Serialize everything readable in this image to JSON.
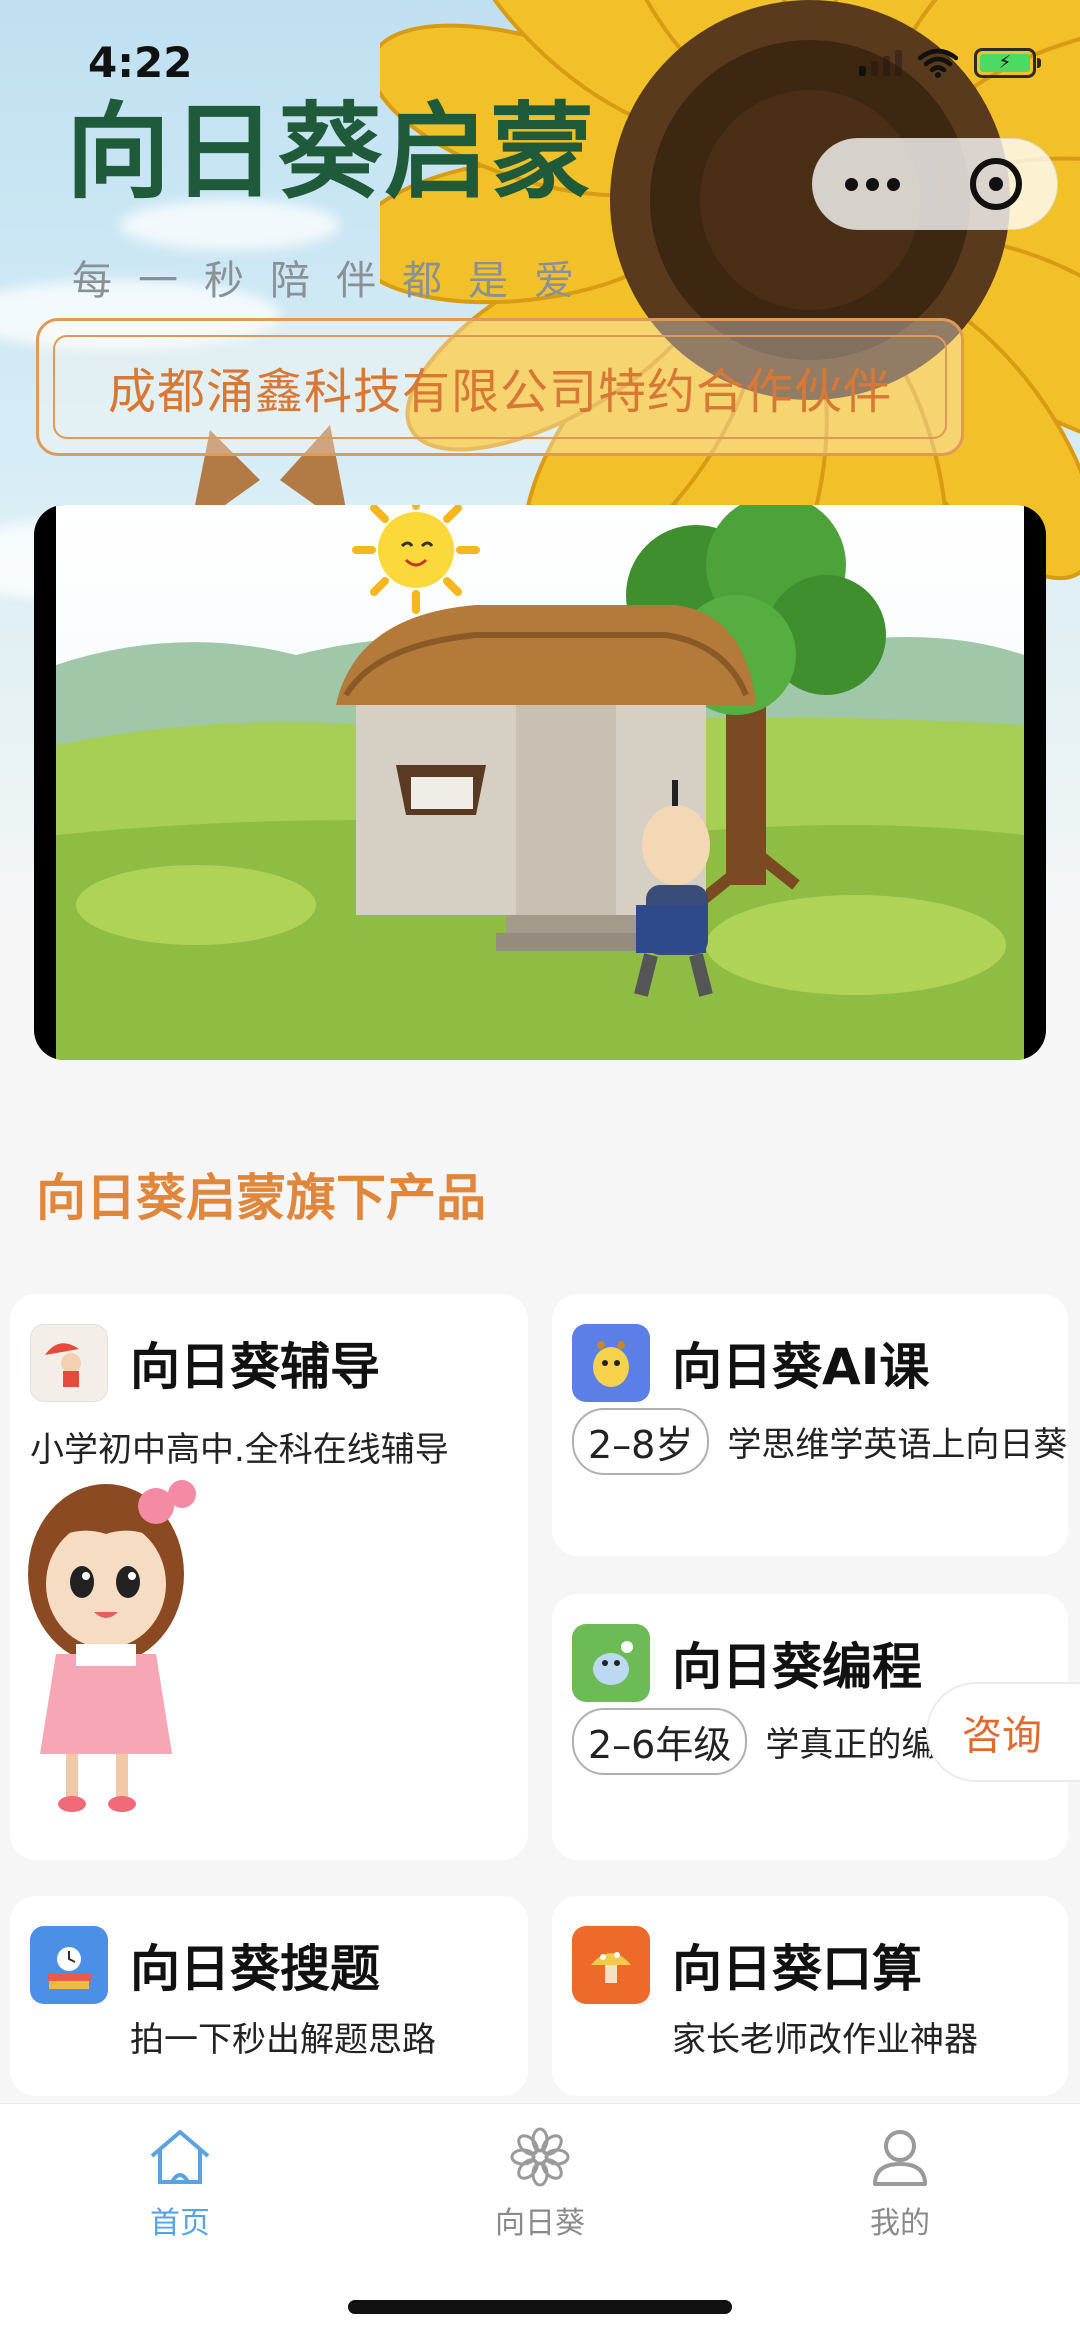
{
  "status": {
    "time": "4:22"
  },
  "brand": {
    "logo_text": "向日葵启蒙",
    "slogan": "每一秒陪伴都是爱"
  },
  "partner_banner": {
    "text": "成都涌鑫科技有限公司特约合作伙伴"
  },
  "section": {
    "title": "向日葵启蒙旗下产品"
  },
  "products": [
    {
      "name": "向日葵辅导",
      "desc": "小学初中高中.全科在线辅导",
      "icon": "girl-umbrella-icon",
      "color": "#f3efe8"
    },
    {
      "name": "向日葵AI课",
      "tag": "2–8岁",
      "desc": "学思维学英语上向日葵",
      "icon": "giraffe-icon",
      "color": "#5b7fe6"
    },
    {
      "name": "向日葵编程",
      "tag": "2–6年级",
      "desc": "学真正的编...",
      "icon": "hippo-icon",
      "color": "#6cbb56"
    },
    {
      "name": "向日葵搜题",
      "desc": "拍一下秒出解题思路",
      "icon": "books-clock-icon",
      "color": "#4b8fe6"
    },
    {
      "name": "向日葵口算",
      "desc": "家长老师改作业神器",
      "icon": "mushroom-icon",
      "color": "#ee6a2a"
    }
  ],
  "consult": {
    "label": "咨询"
  },
  "tabbar": [
    {
      "label": "首页",
      "icon": "home-icon",
      "active": true
    },
    {
      "label": "向日葵",
      "icon": "flower-icon",
      "active": false
    },
    {
      "label": "我的",
      "icon": "user-icon",
      "active": false
    }
  ],
  "colors": {
    "accent": "#e0873c",
    "tab_active": "#5aa3e0",
    "tab_inactive": "#8a8a8a"
  }
}
